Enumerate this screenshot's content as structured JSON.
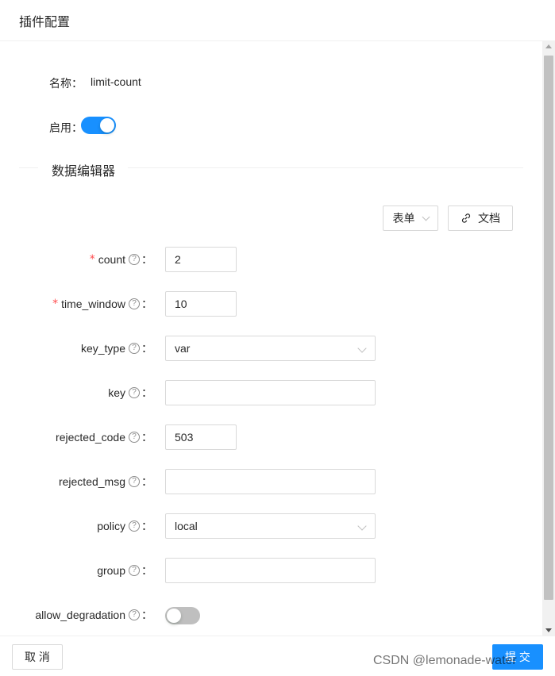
{
  "header": {
    "title": "插件配置"
  },
  "plugin": {
    "name_label": "名称：",
    "name_value": "limit-count",
    "enable_label": "启用：",
    "enabled": true
  },
  "editor": {
    "divider_title": "数据编辑器",
    "mode_select": "表单",
    "docs_button": "文档"
  },
  "form": {
    "fields": [
      {
        "label": "count",
        "required": true,
        "value": "2",
        "type": "input"
      },
      {
        "label": "time_window",
        "required": true,
        "value": "10",
        "type": "input"
      },
      {
        "label": "key_type",
        "required": false,
        "value": "var",
        "type": "select"
      },
      {
        "label": "key",
        "required": false,
        "value": "",
        "type": "input"
      },
      {
        "label": "rejected_code",
        "required": false,
        "value": "503",
        "type": "input"
      },
      {
        "label": "rejected_msg",
        "required": false,
        "value": "",
        "type": "input"
      },
      {
        "label": "policy",
        "required": false,
        "value": "local",
        "type": "select"
      },
      {
        "label": "group",
        "required": false,
        "value": "",
        "type": "input"
      },
      {
        "label": "allow_degradation",
        "required": false,
        "value": false,
        "type": "switch"
      }
    ],
    "help_icon": "question-circle-icon",
    "colon": "："
  },
  "footer": {
    "cancel_label": "取 消",
    "submit_label": "提 交"
  },
  "watermark": "CSDN @lemonade-water",
  "colors": {
    "primary": "#1890ff",
    "required": "#ff4d4f",
    "switch_off": "#bfbfbf"
  }
}
